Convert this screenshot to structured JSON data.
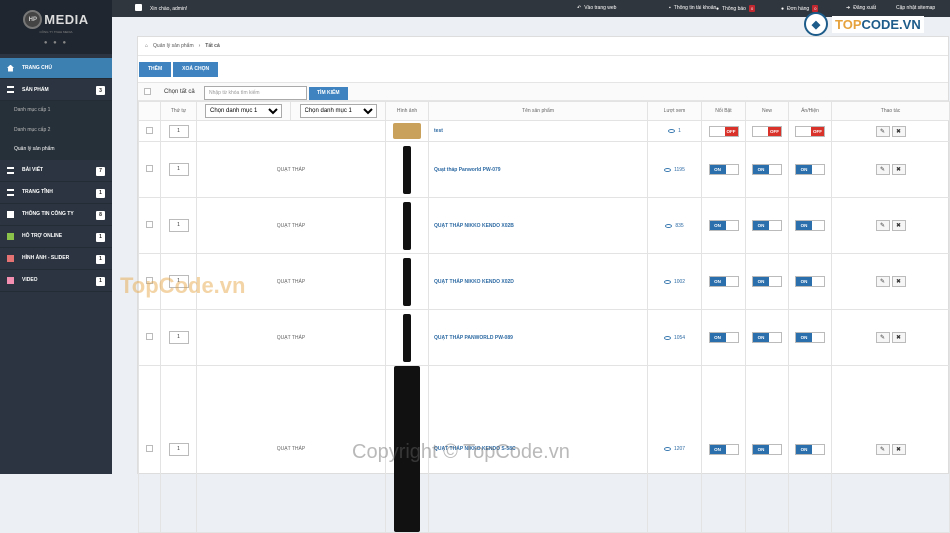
{
  "logo": {
    "name": "MEDIA",
    "mark": "HP",
    "sub": "CÔNG TY TNHH MEDIA"
  },
  "sidebar": {
    "items": [
      {
        "label": "TRANG CHỦ",
        "count": ""
      },
      {
        "label": "SẢN PHẨM",
        "count": "3"
      },
      {
        "label": "BÀI VIẾT",
        "count": "7"
      },
      {
        "label": "TRANG TĨNH",
        "count": "1"
      },
      {
        "label": "THÔNG TIN CÔNG TY",
        "count": "8"
      },
      {
        "label": "HỖ TRỢ ONLINE",
        "count": "1"
      },
      {
        "label": "HÌNH ẢNH - SLIDER",
        "count": "1"
      },
      {
        "label": "VIDEO",
        "count": "1"
      }
    ],
    "sub_items": [
      "Danh mục cấp 1",
      "Danh mục cấp 2",
      "Quản lý sản phẩm"
    ]
  },
  "topbar": {
    "greeting": "Xin chào, admin!",
    "links": [
      {
        "label": "Vào trang web",
        "badge": ""
      },
      {
        "label": "Thông tin tài khoản",
        "badge": ""
      },
      {
        "label": "Thông báo",
        "badge": "0"
      },
      {
        "label": "Đơn hàng",
        "badge": "0"
      },
      {
        "label": "Đăng xuất",
        "badge": ""
      },
      {
        "label": "Cập nhật sitemap",
        "badge": ""
      }
    ]
  },
  "breadcrumb": {
    "home": "Quản lý sản phẩm",
    "current": "Tất cả"
  },
  "toolbar": {
    "add": "THÊM",
    "delete": "XOÁ CHỌN"
  },
  "filter": {
    "select_all": "Chọn tất cả",
    "placeholder": "Nhập từ khóa tìm kiếm",
    "search": "TÌM KIẾM",
    "cat1": "Chọn danh mục 1",
    "cat2": "Chọn danh mục 1"
  },
  "table": {
    "headers": [
      "Thứ tự",
      "",
      "",
      "Hình ảnh",
      "Tên sản phẩm",
      "Lượt xem",
      "Nổi Bật",
      "New",
      "Ẩn/Hiện",
      "Thao tác"
    ],
    "rows": [
      {
        "order": "1",
        "category": "",
        "name": "test",
        "views": "1",
        "noibat": "OFF",
        "new": "OFF",
        "hien": "OFF"
      },
      {
        "order": "1",
        "category": "QUẠT THÁP",
        "name": "Quạt tháp Panworld PW-079",
        "views": "1195",
        "noibat": "ON",
        "new": "ON",
        "hien": "ON"
      },
      {
        "order": "1",
        "category": "QUẠT THÁP",
        "name": "QUẠT THÁP NIKKO KENDO X02B",
        "views": "835",
        "noibat": "ON",
        "new": "ON",
        "hien": "ON"
      },
      {
        "order": "1",
        "category": "QUẠT THÁP",
        "name": "QUẠT THÁP NIKKO KENDO X02D",
        "views": "1002",
        "noibat": "ON",
        "new": "ON",
        "hien": "ON"
      },
      {
        "order": "1",
        "category": "QUẠT THÁP",
        "name": "QUẠT THÁP PANWORLD PW-089",
        "views": "1054",
        "noibat": "ON",
        "new": "ON",
        "hien": "ON"
      },
      {
        "order": "1",
        "category": "QUẠT THÁP",
        "name": "QUẠT THÁP NIKKO KENDO S-58C",
        "views": "1207",
        "noibat": "ON",
        "new": "ON",
        "hien": "ON"
      }
    ]
  },
  "watermarks": {
    "a": "TopCode.vn",
    "b": "Copyright © TopCode.vn",
    "brand1": "TOP",
    "brand2": "CODE.VN"
  },
  "colors": {
    "accent": "#3f84c0",
    "off": "#d9322b",
    "sidebar": "#2b3440"
  }
}
